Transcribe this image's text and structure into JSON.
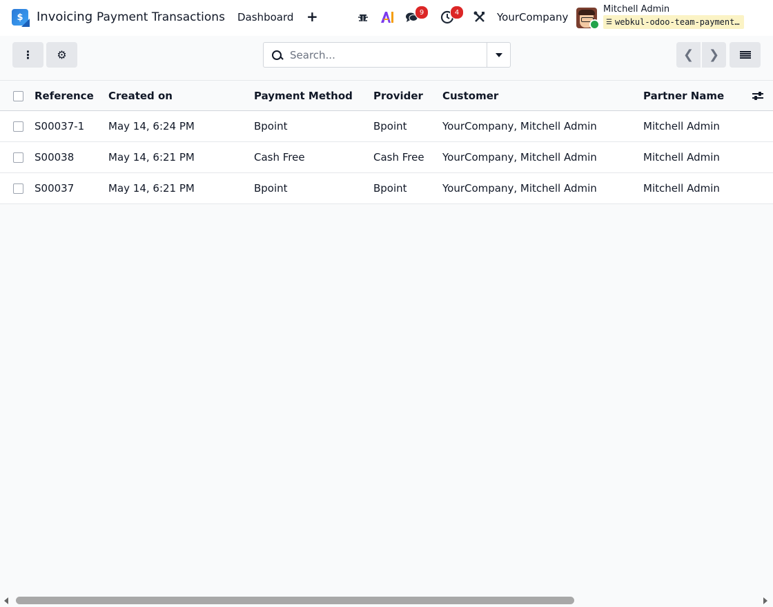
{
  "navbar": {
    "app_name": "Invoicing",
    "menu_title": "Payment Transactions",
    "menu_dashboard": "Dashboard",
    "menu_add": "+",
    "app_icon_glyph": "$",
    "chat_badge": "9",
    "activity_badge": "4",
    "company": "YourCompany",
    "user_name": "Mitchell Admin",
    "database": "webkul-odoo-team-payment…",
    "icons": [
      "app-icon",
      "bug-icon",
      "ai-icon",
      "chat-icon",
      "clock-icon",
      "tools-icon",
      "avatar",
      "database-icon"
    ]
  },
  "control_panel": {
    "search_placeholder": "Search...",
    "icons": [
      "actions-menu-icon",
      "gear-icon",
      "search-icon",
      "caret-down-icon",
      "chevron-left-icon",
      "chevron-right-icon",
      "list-view-icon"
    ]
  },
  "table": {
    "headers": {
      "reference": "Reference",
      "created_on": "Created on",
      "payment_method": "Payment Method",
      "provider": "Provider",
      "customer": "Customer",
      "partner_name": "Partner Name"
    },
    "rows": [
      {
        "reference": "S00037-1",
        "created_on": "May 14, 6:24 PM",
        "payment_method": "Bpoint",
        "provider": "Bpoint",
        "customer": "YourCompany, Mitchell Admin",
        "partner_name": "Mitchell Admin"
      },
      {
        "reference": "S00038",
        "created_on": "May 14, 6:21 PM",
        "payment_method": "Cash Free",
        "provider": "Cash Free",
        "customer": "YourCompany, Mitchell Admin",
        "partner_name": "Mitchell Admin"
      },
      {
        "reference": "S00037",
        "created_on": "May 14, 6:21 PM",
        "payment_method": "Bpoint",
        "provider": "Bpoint",
        "customer": "YourCompany, Mitchell Admin",
        "partner_name": "Mitchell Admin"
      }
    ]
  },
  "colors": {
    "background": "#f9fafb",
    "badge": "#dc2626",
    "db_chip": "#fbf3c5",
    "online": "#22a34a"
  }
}
